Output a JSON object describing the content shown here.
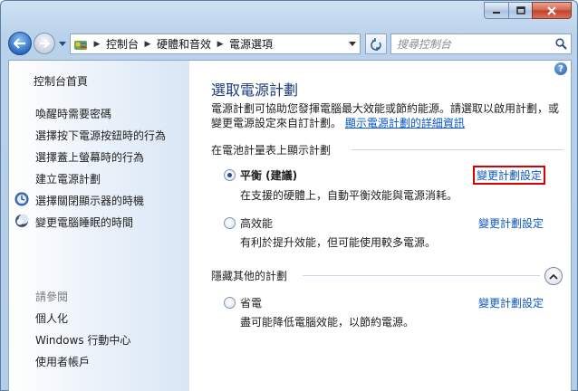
{
  "window": {
    "caption": {
      "minimize_icon": "minimize-icon",
      "maximize_icon": "maximize-icon",
      "close_icon": "close-icon"
    }
  },
  "address_bar": {
    "crumbs": [
      "控制台",
      "硬體和音效",
      "電源選項"
    ]
  },
  "search": {
    "placeholder": "搜尋控制台"
  },
  "sidebar": {
    "home": "控制台首頁",
    "links": [
      "喚醒時需要密碼",
      "選擇按下電源按鈕時的行為",
      "選擇蓋上螢幕時的行為",
      "建立電源計劃",
      "選擇關閉顯示器的時機",
      "變更電腦睡眠的時間"
    ],
    "see_also_heading": "請參閱",
    "see_also": [
      "個人化",
      "Windows 行動中心",
      "使用者帳戶"
    ]
  },
  "main": {
    "title": "選取電源計劃",
    "description_line1": "電源計劃可協助您發揮電腦最大效能或節約能源。請選取以啟用計劃，或",
    "description_line2": "變更電源設定來自訂計劃。",
    "description_link": "顯示電源計劃的詳細資訊",
    "group_battery": "在電池計量表上顯示計劃",
    "group_hidden": "隱藏其他的計劃",
    "plans": [
      {
        "name": "平衡 (建議)",
        "desc": "在支援的硬體上，自動平衡效能與電源消耗。",
        "link": "變更計劃設定",
        "selected": true
      },
      {
        "name": "高效能",
        "desc": "有利於提升效能，但可能使用較多電源。",
        "link": "變更計劃設定",
        "selected": false
      },
      {
        "name": "省電",
        "desc": "盡可能降低電腦效能，以節約電源。",
        "link": "變更計劃設定",
        "selected": false
      }
    ]
  },
  "colors": {
    "link": "#0b57c2",
    "title": "#1b3a7a",
    "highlight_box": "#d60000"
  }
}
